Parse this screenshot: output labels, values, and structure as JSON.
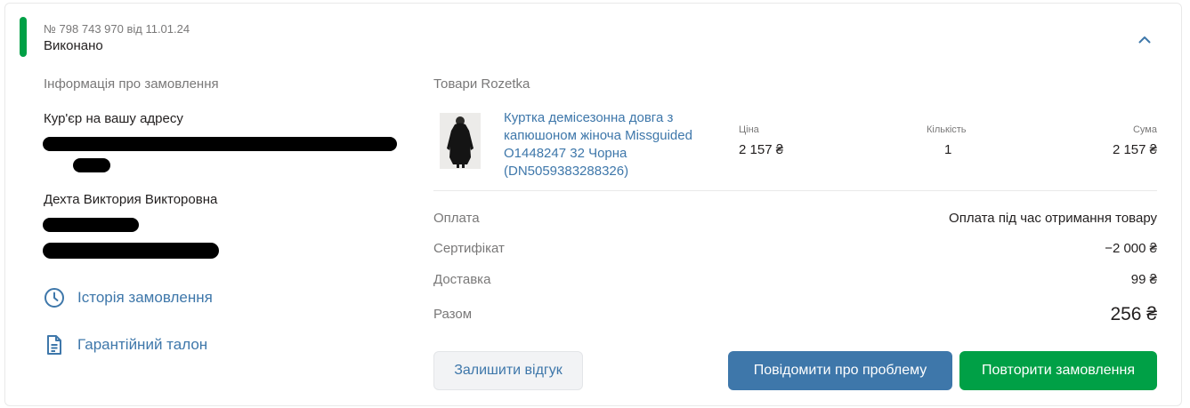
{
  "order": {
    "number_line": "№ 798 743 970 від 11.01.24",
    "status": "Виконано",
    "status_color": "#00a046"
  },
  "info": {
    "title": "Інформація про замовлення",
    "delivery_method": "Кур'єр на вашу адресу",
    "recipient_name": "Дехта Виктория Викторовна"
  },
  "links": {
    "history": "Історія замовлення",
    "warranty": "Гарантійний талон"
  },
  "goods": {
    "title": "Товари Rozetka",
    "columns": {
      "price": "Ціна",
      "quantity": "Кількість",
      "sum": "Сума"
    },
    "product": {
      "name": "Куртка демісезонна довга з капюшоном жіноча Missguided O1448247 32 Чорна (DN5059383288326)",
      "price": "2 157 ₴",
      "quantity": "1",
      "sum": "2 157 ₴"
    }
  },
  "summary": {
    "payment_label": "Оплата",
    "payment_value": "Оплата під час отримання товару",
    "certificate_label": "Сертифікат",
    "certificate_value": "−2 000 ₴",
    "delivery_label": "Доставка",
    "delivery_value": "99 ₴",
    "total_label": "Разом",
    "total_value": "256 ₴"
  },
  "buttons": {
    "review": "Залишити відгук",
    "problem": "Повідомити про проблему",
    "repeat": "Повторити замовлення"
  },
  "colors": {
    "link_blue": "#3e77aa",
    "green": "#00a046"
  }
}
